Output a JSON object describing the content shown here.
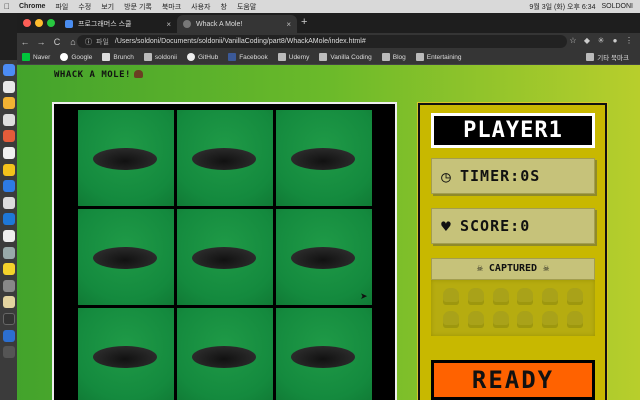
{
  "menubar": {
    "app_name": "Chrome",
    "items": [
      "파일",
      "수정",
      "보기",
      "방문 기록",
      "북마크",
      "사용자",
      "창",
      "도움말"
    ],
    "datetime": "9월 3일 (화) 오후 6:34",
    "user": "SOLDONI"
  },
  "browser": {
    "tabs": [
      {
        "label": "프로그래머스 스쿨"
      },
      {
        "label": "Whack A Mole!"
      }
    ],
    "newtab": "+",
    "nav": {
      "back": "←",
      "forward": "→",
      "reload": "C",
      "home": "⌂"
    },
    "address": {
      "label": "파일",
      "url": "/Users/soldoni/Documents/soldonii/VanillaCoding/part8/WhackAMole/index.html#"
    },
    "bookmarks": [
      "Naver",
      "Google",
      "Brunch",
      "soldonii",
      "GitHub",
      "Facebook",
      "Udemy",
      "Vanilla Coding",
      "Blog",
      "Entertaining"
    ],
    "other_bookmarks": "기타 북마크"
  },
  "game": {
    "title": "WHACK A MOLE!",
    "player": "PLAYER1",
    "timer_label": "TIMER:",
    "timer_value": "0S",
    "score_label": "SCORE:",
    "score_value": "0",
    "captured_label": "CAPTURED",
    "ready_label": "READY"
  },
  "icons": {
    "timer": "clock-icon",
    "score": "heart-icon",
    "captured": "invader-icon"
  },
  "colors": {
    "page_gradient": [
      "#43a32c",
      "#b8ce2c"
    ],
    "cell_green": "#1a9244",
    "panel": "#c8b800",
    "ready": "#ff6200"
  }
}
